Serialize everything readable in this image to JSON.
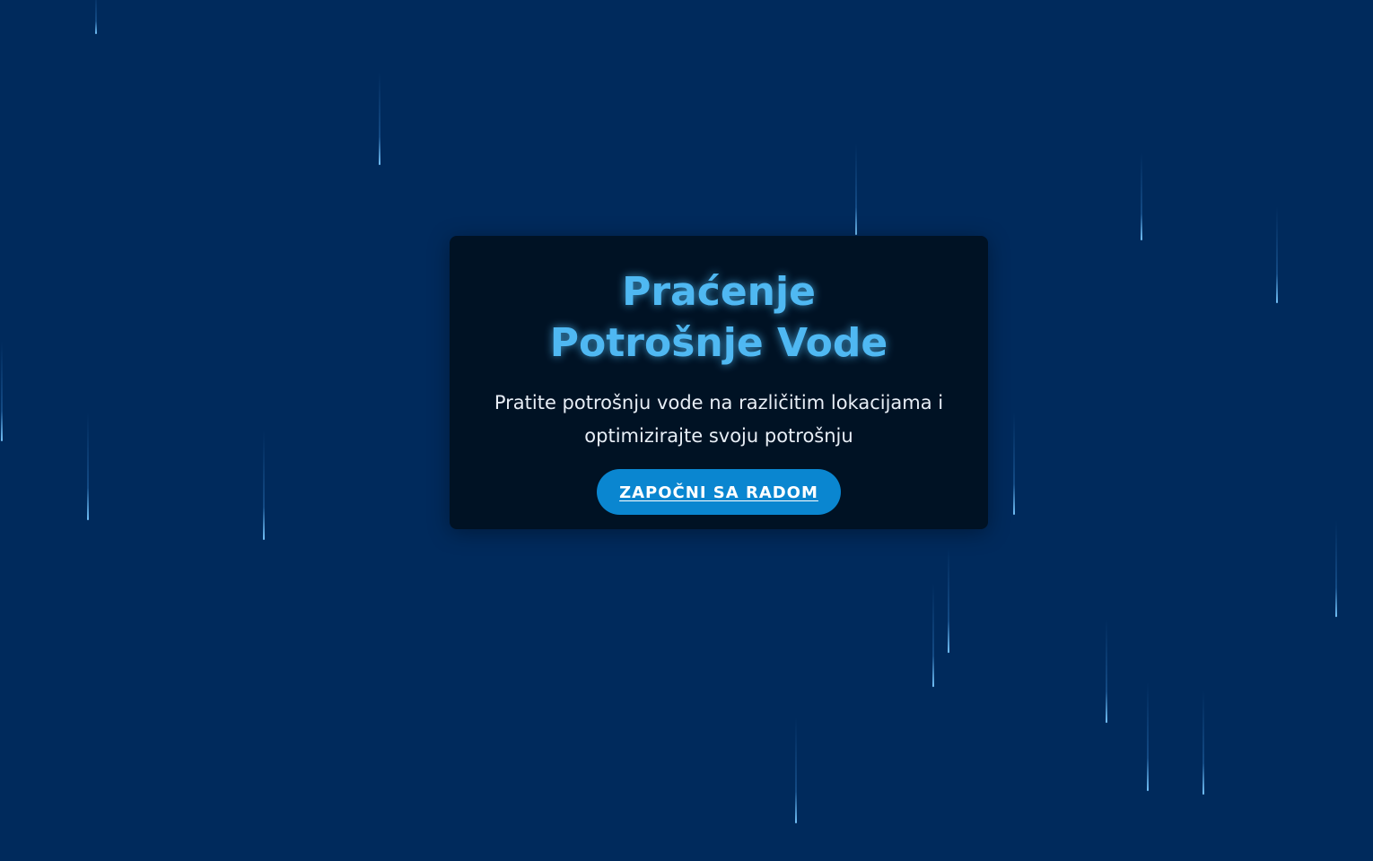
{
  "hero": {
    "title": "Praćenje Potrošnje Vode",
    "subtitle": "Pratite potrošnju vode na različitim lokacijama i optimizirajte svoju potrošnju",
    "cta_label": "ZAPOČNI SA RADOM"
  },
  "colors": {
    "background": "#002a5c",
    "card": "#001224",
    "title": "#4fb8f2",
    "accent": "#0a86d0",
    "rain": "#4facfe"
  }
}
